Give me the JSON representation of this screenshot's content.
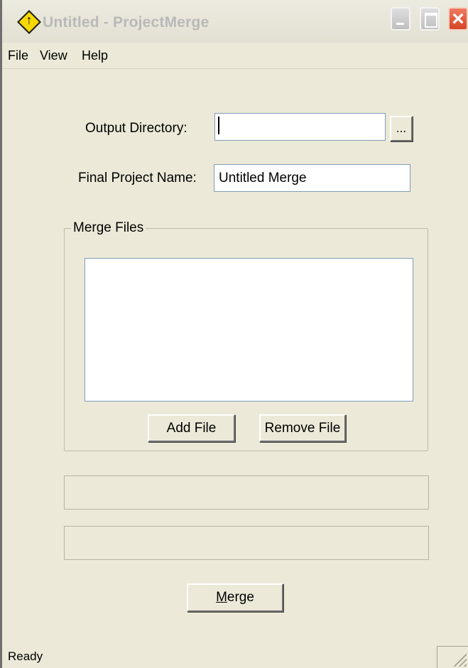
{
  "window": {
    "title": "Untitled - ProjectMerge",
    "app_icon_glyph": "↑",
    "close_glyph": "×"
  },
  "menu": {
    "items": [
      {
        "label": "File"
      },
      {
        "label": "View"
      },
      {
        "label": "Help"
      }
    ]
  },
  "form": {
    "output_directory_label": "Output Directory:",
    "output_directory_value": "",
    "browse_button_label": "...",
    "final_project_name_label": "Final Project Name:",
    "final_project_name_value": "Untitled Merge"
  },
  "merge_files": {
    "group_label": "Merge Files",
    "add_file_label": "Add File",
    "remove_file_label": "Remove File",
    "items": []
  },
  "progress": {
    "bar1_fraction": 0,
    "bar2_fraction": 0
  },
  "actions": {
    "merge_label_prefix": "",
    "merge_label_underlined": "M",
    "merge_label_suffix": "erge"
  },
  "status": {
    "text": "Ready"
  },
  "theme": {
    "window_bg": "#ece9d8",
    "input_border": "#7f9db9",
    "title_text_color": "#b9b9b9",
    "close_button_color": "#d54522",
    "icon_yellow": "#f7d800"
  },
  "icons": {
    "app": "diamond-warning-icon",
    "minimize": "minimize-icon",
    "maximize": "maximize-icon",
    "close": "close-icon",
    "resize_grip": "resize-grip-icon"
  }
}
